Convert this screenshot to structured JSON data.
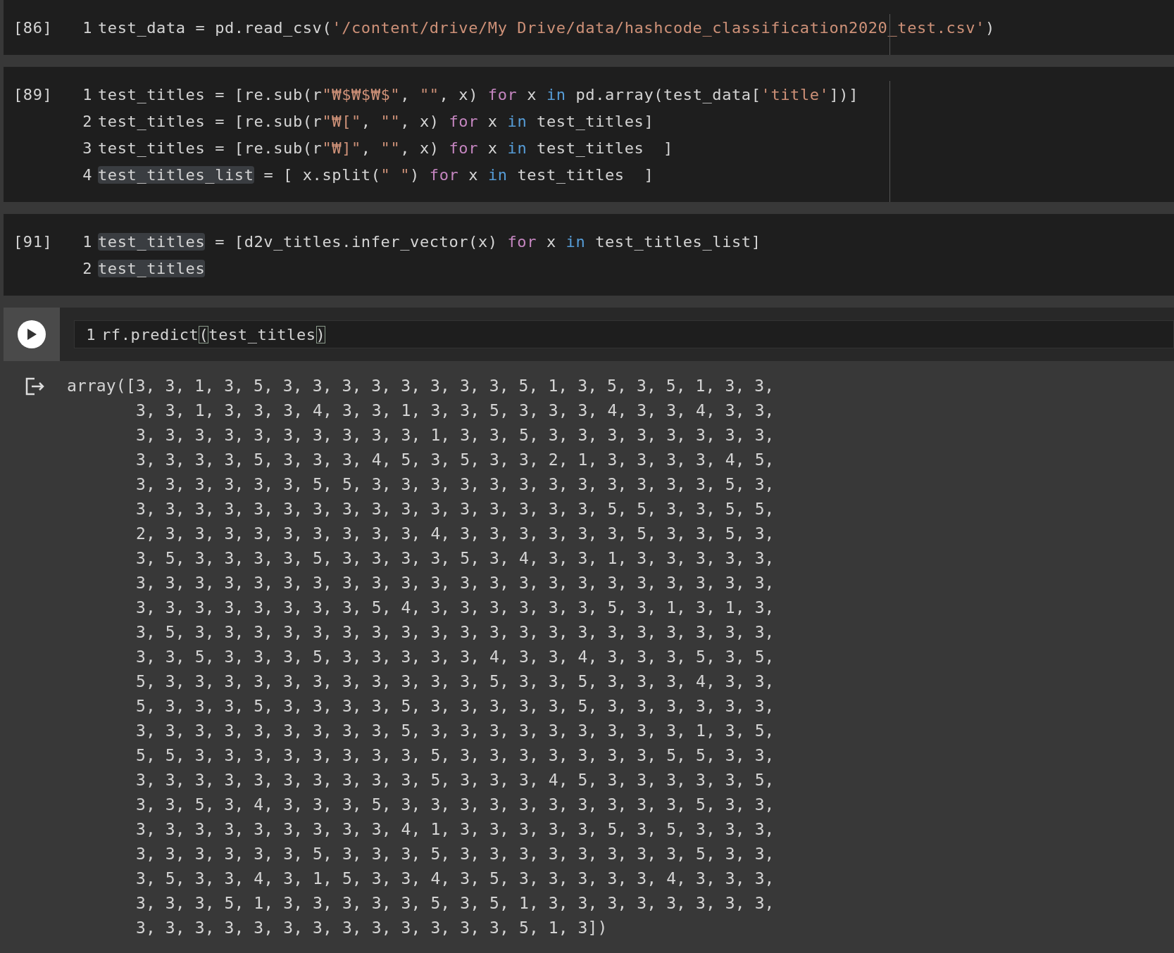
{
  "cells": [
    {
      "kind": "executed",
      "count": "[86]",
      "ruler": true,
      "lines": [
        {
          "number": "1",
          "tokens": [
            {
              "text": "test_data = pd.read_csv(",
              "kind": "plain"
            },
            {
              "text": "'/content/drive/My Drive/data/hashcode_classification2020_test.csv'",
              "kind": "string"
            },
            {
              "text": ")",
              "kind": "plain"
            }
          ]
        }
      ]
    },
    {
      "kind": "executed",
      "count": "[89]",
      "ruler": true,
      "lines": [
        {
          "number": "1",
          "tokens": [
            {
              "text": "test_titles = [re.sub(r",
              "kind": "plain"
            },
            {
              "text": "\"₩$₩$₩$\"",
              "kind": "string"
            },
            {
              "text": ", ",
              "kind": "plain"
            },
            {
              "text": "\"\"",
              "kind": "string"
            },
            {
              "text": ", x) ",
              "kind": "plain"
            },
            {
              "text": "for",
              "kind": "keyword"
            },
            {
              "text": " x ",
              "kind": "plain"
            },
            {
              "text": "in",
              "kind": "operator"
            },
            {
              "text": " pd.array(test_data[",
              "kind": "plain"
            },
            {
              "text": "'title'",
              "kind": "string"
            },
            {
              "text": "])]",
              "kind": "plain"
            }
          ]
        },
        {
          "number": "2",
          "tokens": [
            {
              "text": "test_titles = [re.sub(r",
              "kind": "plain"
            },
            {
              "text": "\"₩[\"",
              "kind": "string"
            },
            {
              "text": ", ",
              "kind": "plain"
            },
            {
              "text": "\"\"",
              "kind": "string"
            },
            {
              "text": ", x) ",
              "kind": "plain"
            },
            {
              "text": "for",
              "kind": "keyword"
            },
            {
              "text": " x ",
              "kind": "plain"
            },
            {
              "text": "in",
              "kind": "operator"
            },
            {
              "text": " test_titles]",
              "kind": "plain"
            }
          ]
        },
        {
          "number": "3",
          "tokens": [
            {
              "text": "test_titles = [re.sub(r",
              "kind": "plain"
            },
            {
              "text": "\"₩]\"",
              "kind": "string"
            },
            {
              "text": ", ",
              "kind": "plain"
            },
            {
              "text": "\"\"",
              "kind": "string"
            },
            {
              "text": ", x) ",
              "kind": "plain"
            },
            {
              "text": "for",
              "kind": "keyword"
            },
            {
              "text": " x ",
              "kind": "plain"
            },
            {
              "text": "in",
              "kind": "operator"
            },
            {
              "text": " test_titles  ]",
              "kind": "plain"
            }
          ]
        },
        {
          "number": "4",
          "tokens": [
            {
              "text": "test_titles_list",
              "kind": "highlight"
            },
            {
              "text": " = [ x.split(",
              "kind": "plain"
            },
            {
              "text": "\" \"",
              "kind": "string"
            },
            {
              "text": ") ",
              "kind": "plain"
            },
            {
              "text": "for",
              "kind": "keyword"
            },
            {
              "text": " x ",
              "kind": "plain"
            },
            {
              "text": "in",
              "kind": "operator"
            },
            {
              "text": " test_titles  ]",
              "kind": "plain"
            }
          ]
        }
      ]
    },
    {
      "kind": "executed",
      "count": "[91]",
      "ruler": false,
      "lines": [
        {
          "number": "1",
          "tokens": [
            {
              "text": "test_titles",
              "kind": "highlight"
            },
            {
              "text": " = [d2v_titles.infer_vector(x) ",
              "kind": "plain"
            },
            {
              "text": "for",
              "kind": "keyword"
            },
            {
              "text": " x ",
              "kind": "plain"
            },
            {
              "text": "in",
              "kind": "operator"
            },
            {
              "text": " test_titles_list]",
              "kind": "plain"
            }
          ]
        },
        {
          "number": "2",
          "tokens": [
            {
              "text": "test_titles",
              "kind": "highlight"
            }
          ]
        }
      ]
    },
    {
      "kind": "pending",
      "ruler": false,
      "lines": [
        {
          "number": "1",
          "tokens": [
            {
              "text": "rf.predict",
              "kind": "plain"
            },
            {
              "text": "(",
              "kind": "bracket"
            },
            {
              "text": "test_titles",
              "kind": "plain"
            },
            {
              "text": ")",
              "kind": "bracket"
            }
          ]
        }
      ]
    }
  ],
  "output": {
    "lines": [
      "array([3, 3, 1, 3, 5, 3, 3, 3, 3, 3, 3, 3, 3, 5, 1, 3, 5, 3, 5, 1, 3, 3,",
      "3, 3, 1, 3, 3, 3, 4, 3, 3, 1, 3, 3, 5, 3, 3, 3, 4, 3, 3, 4, 3, 3,",
      "3, 3, 3, 3, 3, 3, 3, 3, 3, 3, 1, 3, 3, 5, 3, 3, 3, 3, 3, 3, 3, 3,",
      "3, 3, 3, 3, 5, 3, 3, 3, 4, 5, 3, 5, 3, 3, 2, 1, 3, 3, 3, 3, 4, 5,",
      "3, 3, 3, 3, 3, 3, 5, 5, 3, 3, 3, 3, 3, 3, 3, 3, 3, 3, 3, 3, 5, 3,",
      "3, 3, 3, 3, 3, 3, 3, 3, 3, 3, 3, 3, 3, 3, 3, 3, 5, 5, 3, 3, 5, 5,",
      "2, 3, 3, 3, 3, 3, 3, 3, 3, 3, 4, 3, 3, 3, 3, 3, 3, 5, 3, 3, 5, 3,",
      "3, 5, 3, 3, 3, 3, 5, 3, 3, 3, 3, 5, 3, 4, 3, 3, 1, 3, 3, 3, 3, 3,",
      "3, 3, 3, 3, 3, 3, 3, 3, 3, 3, 3, 3, 3, 3, 3, 3, 3, 3, 3, 3, 3, 3,",
      "3, 3, 3, 3, 3, 3, 3, 3, 5, 4, 3, 3, 3, 3, 3, 3, 5, 3, 1, 3, 1, 3,",
      "3, 5, 3, 3, 3, 3, 3, 3, 3, 3, 3, 3, 3, 3, 3, 3, 3, 3, 3, 3, 3, 3,",
      "3, 3, 5, 3, 3, 3, 5, 3, 3, 3, 3, 3, 4, 3, 3, 4, 3, 3, 3, 5, 3, 5,",
      "5, 3, 3, 3, 3, 3, 3, 3, 3, 3, 3, 3, 5, 3, 3, 5, 3, 3, 3, 4, 3, 3,",
      "5, 3, 3, 3, 5, 3, 3, 3, 3, 5, 3, 3, 3, 3, 3, 5, 3, 3, 3, 3, 3, 3,",
      "3, 3, 3, 3, 3, 3, 3, 3, 3, 5, 3, 3, 3, 3, 3, 3, 3, 3, 3, 1, 3, 5,",
      "5, 5, 3, 3, 3, 3, 3, 3, 3, 3, 5, 3, 3, 3, 3, 3, 3, 3, 5, 5, 3, 3,",
      "3, 3, 3, 3, 3, 3, 3, 3, 3, 3, 5, 3, 3, 3, 4, 5, 3, 3, 3, 3, 3, 5,",
      "3, 3, 5, 3, 4, 3, 3, 3, 5, 3, 3, 3, 3, 3, 3, 3, 3, 3, 3, 5, 3, 3,",
      "3, 3, 3, 3, 3, 3, 3, 3, 3, 4, 1, 3, 3, 3, 3, 3, 5, 3, 5, 3, 3, 3,",
      "3, 3, 3, 3, 3, 3, 5, 3, 3, 3, 5, 3, 3, 3, 3, 3, 3, 3, 3, 5, 3, 3,",
      "3, 5, 3, 3, 4, 3, 1, 5, 3, 3, 4, 3, 5, 3, 3, 3, 3, 3, 4, 3, 3, 3,",
      "3, 3, 3, 5, 1, 3, 3, 3, 3, 3, 5, 3, 5, 1, 3, 3, 3, 3, 3, 3, 3, 3,",
      "3, 3, 3, 3, 3, 3, 3, 3, 3, 3, 3, 3, 3, 5, 1, 3])"
    ]
  }
}
